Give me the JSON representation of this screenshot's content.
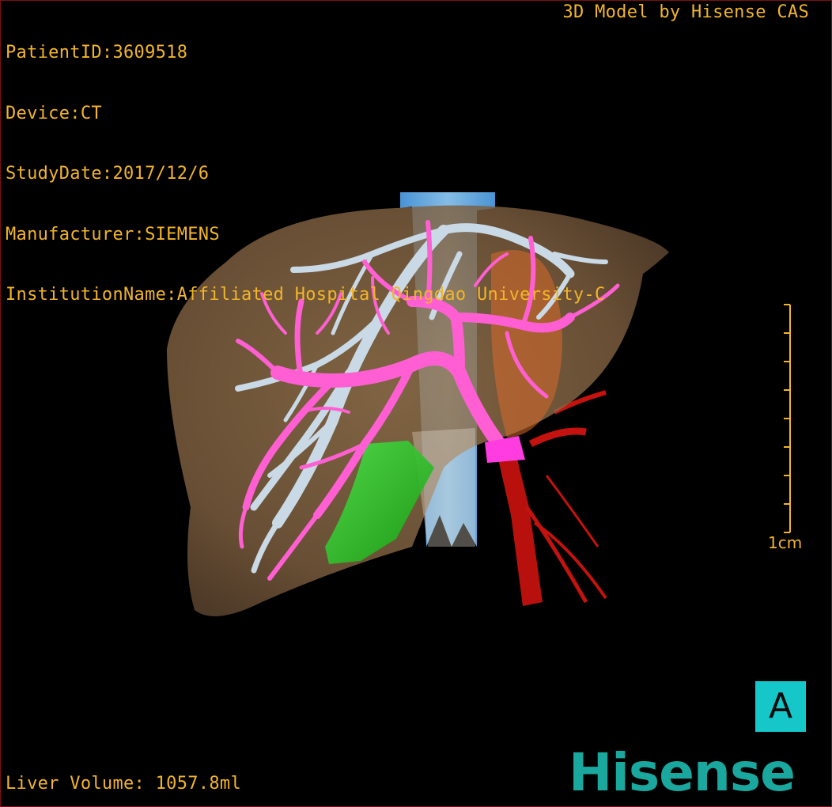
{
  "study_info": {
    "patient_id": "PatientID:3609518",
    "device": "Device:CT",
    "study_date": "StudyDate:2017/12/6",
    "manufacturer": "Manufacturer:SIEMENS",
    "institution": "InstitutionName:Affiliated Hospital Qingdao University-C"
  },
  "vendor_caption": "3D Model by Hisense CAS",
  "measurements": {
    "liver_volume": "Liver Volume: 1057.8ml"
  },
  "scale_bar": {
    "label": "1cm",
    "ticks": 9
  },
  "orientation": {
    "label": "A"
  },
  "brand": {
    "name": "Hisense"
  },
  "colors": {
    "text_overlay": "#f2b52a",
    "liver": "#8b6a44",
    "portal_vein": "#ff5fd2",
    "hepatic_vein": "#c9d9e6",
    "ivc": "#5aa8e8",
    "artery": "#c4120e",
    "gallbladder": "#2fd12a",
    "orientation_cube": "#16c7c9",
    "brand": "#19a79e",
    "frame": "#7a1010"
  },
  "structures": [
    "liver",
    "inferior-vena-cava",
    "hepatic-veins",
    "portal-vein",
    "hepatic-artery",
    "gallbladder"
  ]
}
